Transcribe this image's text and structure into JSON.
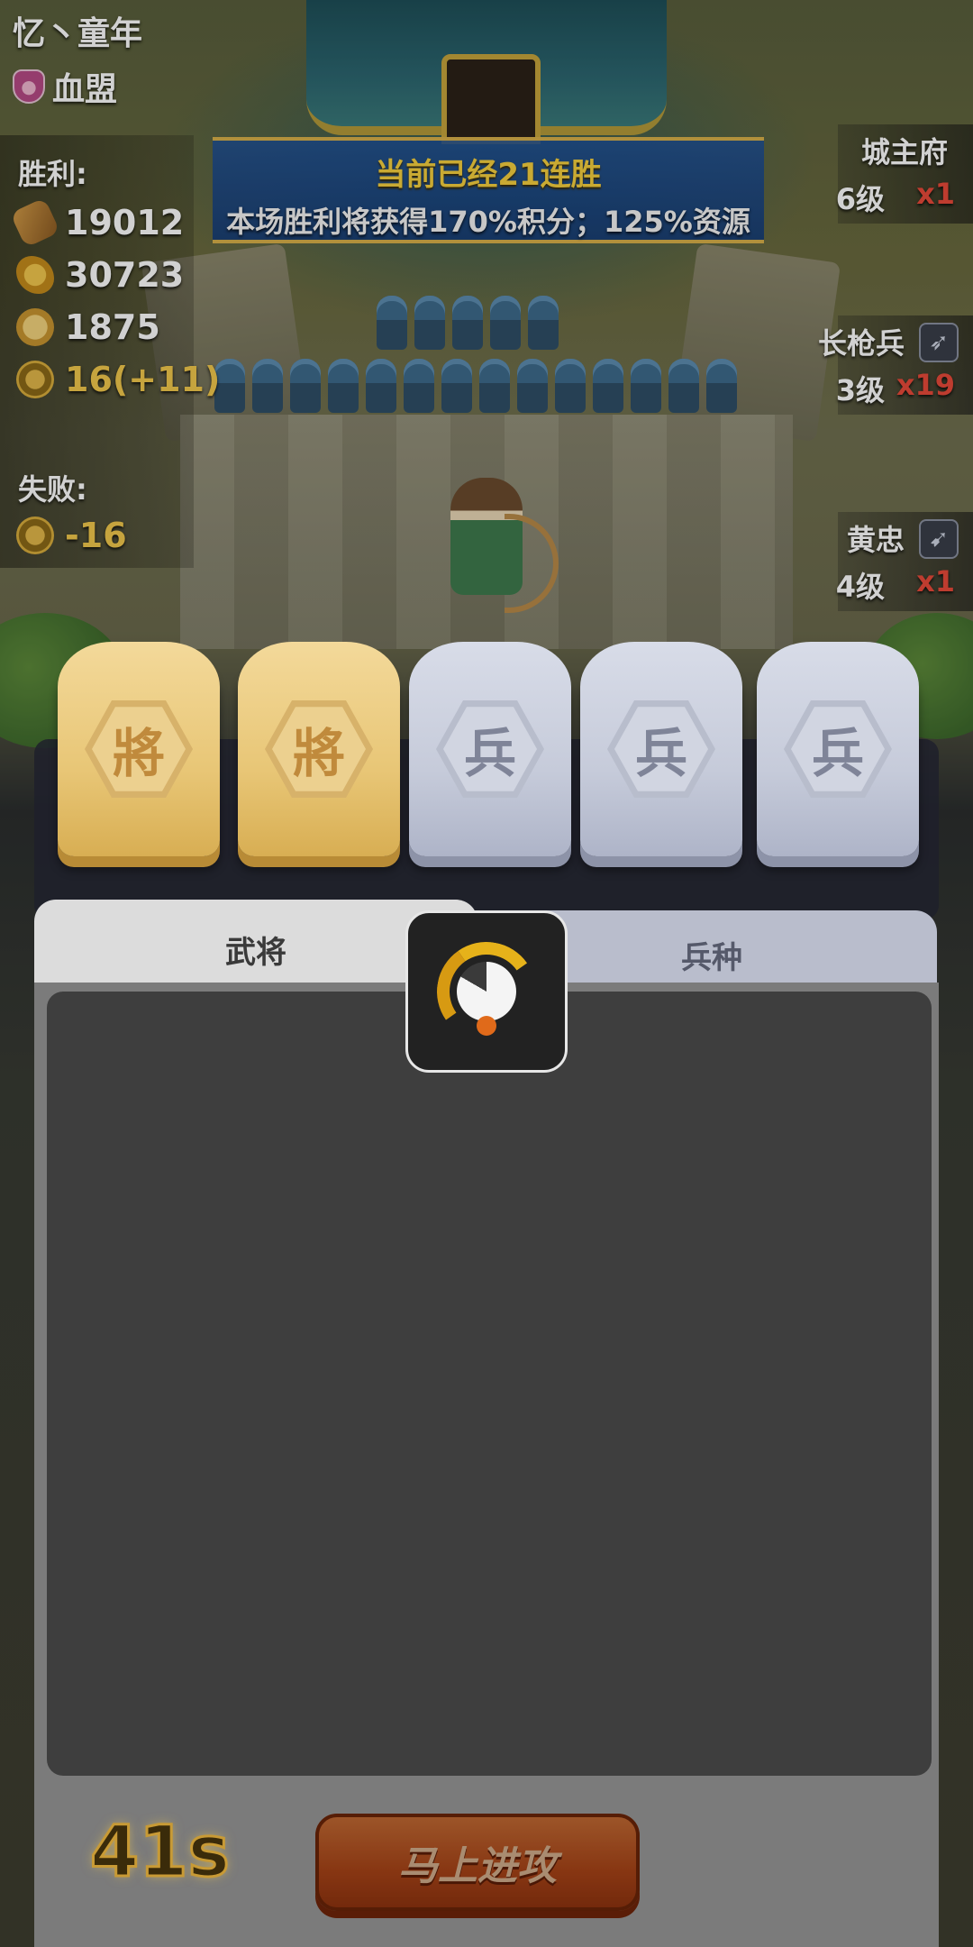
{
  "player": {
    "name": "忆丶童年",
    "alliance": "血盟"
  },
  "rewards": {
    "victory_label": "胜利:",
    "victory": [
      {
        "icon": "wood-icon",
        "value": "19012"
      },
      {
        "icon": "grain-icon",
        "value": "30723"
      },
      {
        "icon": "coin-icon",
        "value": "1875"
      },
      {
        "icon": "medal-icon",
        "value": "16(+11)"
      }
    ],
    "defeat_label": "失败:",
    "defeat": [
      {
        "icon": "medal-icon",
        "value": "-16"
      }
    ]
  },
  "streak": {
    "title": "当前已经21连胜",
    "reward": "本场胜利将获得170%积分；125%资源"
  },
  "enemy": [
    {
      "name": "城主府",
      "level": "6级",
      "count": "x1"
    },
    {
      "name": "长枪兵",
      "level": "3级",
      "count": "x19",
      "badge": "spear-icon"
    },
    {
      "name": "黄忠",
      "level": "4级",
      "count": "x1",
      "badge": "bow-icon"
    }
  ],
  "slots": [
    {
      "type": "general",
      "glyph": "將"
    },
    {
      "type": "general",
      "glyph": "將"
    },
    {
      "type": "soldier",
      "glyph": "兵"
    },
    {
      "type": "soldier",
      "glyph": "兵"
    },
    {
      "type": "soldier",
      "glyph": "兵"
    }
  ],
  "tabs": {
    "general": "武将",
    "troop": "兵种"
  },
  "timer": "41s",
  "attack_button": "马上进攻",
  "colors": {
    "streak_title": "#f6d03f",
    "enemy_count": "#e84a3a",
    "attack_button": "#c24e1b",
    "loader_accent": "#e6b21a"
  }
}
